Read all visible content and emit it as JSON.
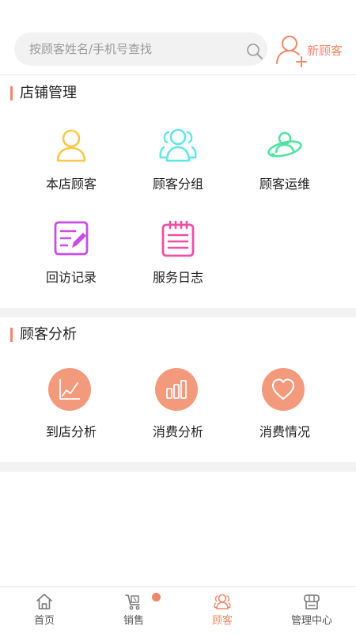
{
  "search": {
    "placeholder": "按顾客姓名/手机号查找",
    "value": "",
    "icon": "search-icon"
  },
  "new_customer": {
    "label": "新顾客",
    "icon": "add-user-icon",
    "color": "#f0876a"
  },
  "store_management": {
    "title": "店铺管理",
    "items": [
      {
        "label": "本店顾客",
        "icon": "person-icon",
        "color": "#f7c844"
      },
      {
        "label": "顾客分组",
        "icon": "group-icon",
        "color": "#5ee6e6"
      },
      {
        "label": "顾客运维",
        "icon": "orbit-person-icon",
        "color": "#4fe3a0"
      },
      {
        "label": "回访记录",
        "icon": "edit-note-icon",
        "color": "#c94ce8"
      },
      {
        "label": "服务日志",
        "icon": "notepad-icon",
        "color": "#f04fa6"
      }
    ]
  },
  "customer_analysis": {
    "title": "顾客分析",
    "items": [
      {
        "label": "到店分析",
        "icon": "line-chart-icon"
      },
      {
        "label": "消费分析",
        "icon": "bar-chart-icon"
      },
      {
        "label": "消费情况",
        "icon": "heart-icon"
      }
    ],
    "circle_color": "#f49a7c"
  },
  "tabbar": {
    "tabs": [
      {
        "label": "首页",
        "icon": "home-icon",
        "active": false
      },
      {
        "label": "销售",
        "icon": "cart-icon",
        "active": false,
        "badge": true
      },
      {
        "label": "顾客",
        "icon": "customers-icon",
        "active": true
      },
      {
        "label": "管理中心",
        "icon": "store-icon",
        "active": false
      }
    ],
    "active_color": "#f0876a"
  },
  "accent_color": "#f0876a"
}
